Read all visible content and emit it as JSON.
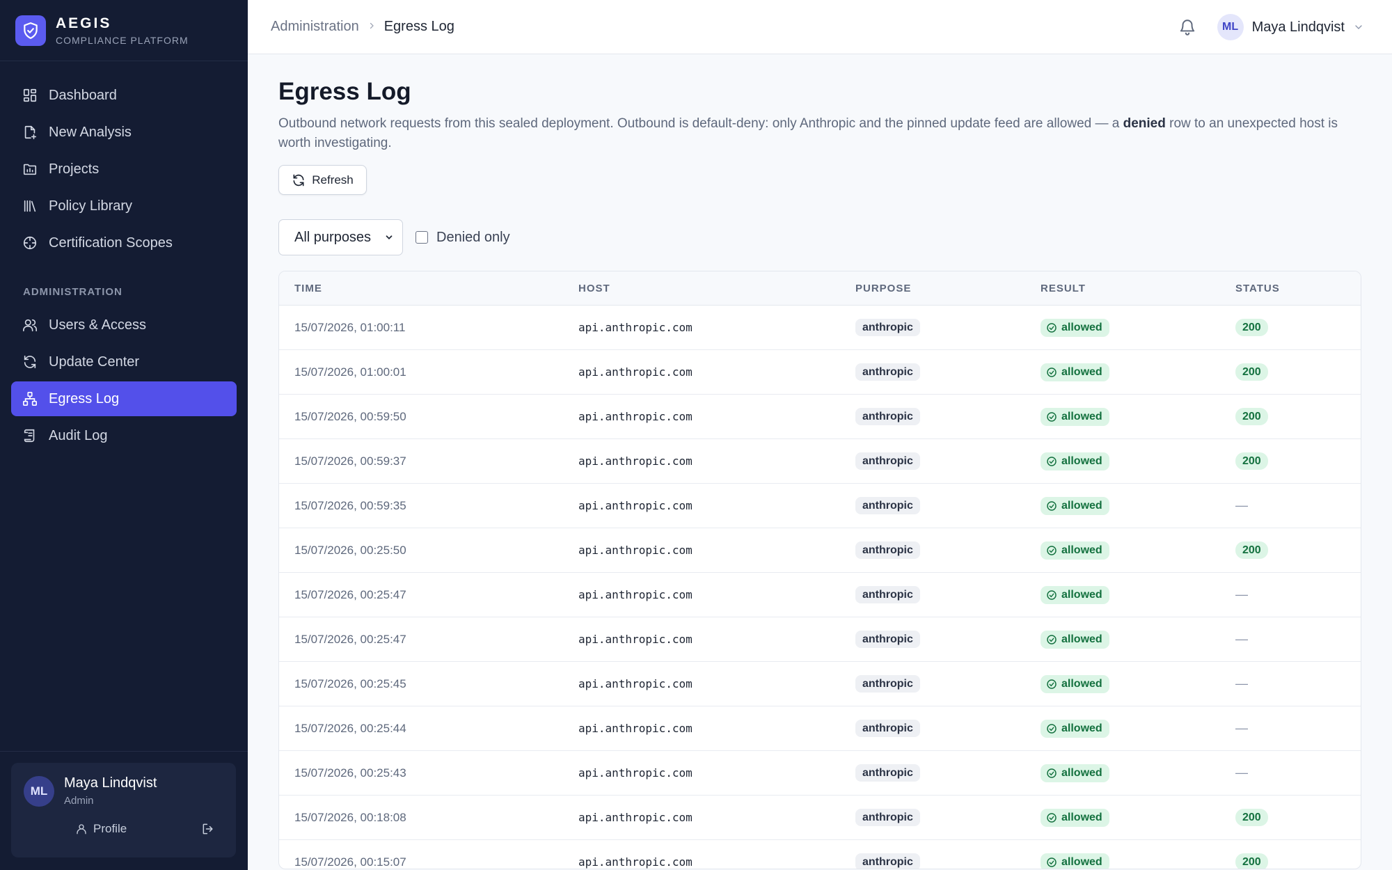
{
  "brand": {
    "name": "AEGIS",
    "subtitle": "COMPLIANCE PLATFORM"
  },
  "sidebar": {
    "items": [
      {
        "label": "Dashboard",
        "icon": "dashboard-icon"
      },
      {
        "label": "New Analysis",
        "icon": "file-plus-icon"
      },
      {
        "label": "Projects",
        "icon": "folder-chart-icon"
      },
      {
        "label": "Policy Library",
        "icon": "library-icon"
      },
      {
        "label": "Certification Scopes",
        "icon": "target-icon"
      }
    ],
    "section_label": "ADMINISTRATION",
    "admin_items": [
      {
        "label": "Users & Access",
        "icon": "users-icon"
      },
      {
        "label": "Update Center",
        "icon": "refresh-icon"
      },
      {
        "label": "Egress Log",
        "icon": "network-icon",
        "active": true
      },
      {
        "label": "Audit Log",
        "icon": "scroll-icon"
      }
    ],
    "user": {
      "initials": "ML",
      "name": "Maya Lindqvist",
      "role": "Admin",
      "profile_label": "Profile"
    }
  },
  "topbar": {
    "breadcrumb": {
      "parent": "Administration",
      "current": "Egress Log"
    },
    "user": {
      "initials": "ML",
      "name": "Maya Lindqvist"
    }
  },
  "page": {
    "title": "Egress Log",
    "description_before": "Outbound network requests from this sealed deployment. Outbound is default-deny: only Anthropic and the pinned update feed are allowed — a ",
    "description_bold": "denied",
    "description_after": " row to an unexpected host is worth investigating.",
    "refresh_label": "Refresh",
    "filter_select": "All purposes",
    "denied_only_label": "Denied only"
  },
  "table": {
    "headers": {
      "time": "TIME",
      "host": "HOST",
      "purpose": "PURPOSE",
      "result": "RESULT",
      "status": "STATUS"
    },
    "rows": [
      {
        "time": "15/07/2026, 01:00:11",
        "host": "api.anthropic.com",
        "purpose": "anthropic",
        "result": "allowed",
        "status": "200"
      },
      {
        "time": "15/07/2026, 01:00:01",
        "host": "api.anthropic.com",
        "purpose": "anthropic",
        "result": "allowed",
        "status": "200"
      },
      {
        "time": "15/07/2026, 00:59:50",
        "host": "api.anthropic.com",
        "purpose": "anthropic",
        "result": "allowed",
        "status": "200"
      },
      {
        "time": "15/07/2026, 00:59:37",
        "host": "api.anthropic.com",
        "purpose": "anthropic",
        "result": "allowed",
        "status": "200"
      },
      {
        "time": "15/07/2026, 00:59:35",
        "host": "api.anthropic.com",
        "purpose": "anthropic",
        "result": "allowed",
        "status": "—"
      },
      {
        "time": "15/07/2026, 00:25:50",
        "host": "api.anthropic.com",
        "purpose": "anthropic",
        "result": "allowed",
        "status": "200"
      },
      {
        "time": "15/07/2026, 00:25:47",
        "host": "api.anthropic.com",
        "purpose": "anthropic",
        "result": "allowed",
        "status": "—"
      },
      {
        "time": "15/07/2026, 00:25:47",
        "host": "api.anthropic.com",
        "purpose": "anthropic",
        "result": "allowed",
        "status": "—"
      },
      {
        "time": "15/07/2026, 00:25:45",
        "host": "api.anthropic.com",
        "purpose": "anthropic",
        "result": "allowed",
        "status": "—"
      },
      {
        "time": "15/07/2026, 00:25:44",
        "host": "api.anthropic.com",
        "purpose": "anthropic",
        "result": "allowed",
        "status": "—"
      },
      {
        "time": "15/07/2026, 00:25:43",
        "host": "api.anthropic.com",
        "purpose": "anthropic",
        "result": "allowed",
        "status": "—"
      },
      {
        "time": "15/07/2026, 00:18:08",
        "host": "api.anthropic.com",
        "purpose": "anthropic",
        "result": "allowed",
        "status": "200"
      },
      {
        "time": "15/07/2026, 00:15:07",
        "host": "api.anthropic.com",
        "purpose": "anthropic",
        "result": "allowed",
        "status": "200"
      }
    ]
  },
  "colors": {
    "sidebar_bg": "#141c33",
    "accent": "#5350ea",
    "success_bg": "#dcf5e6",
    "success_text": "#14713f"
  }
}
